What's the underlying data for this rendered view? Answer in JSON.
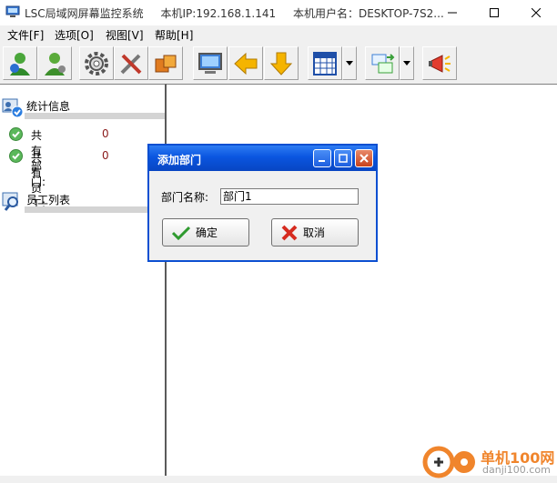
{
  "titlebar": {
    "app_name": "LSC局域网屏幕监控系统",
    "ip": "本机IP:192.168.1.141",
    "user": "本机用户名：DESKTOP-7S2..."
  },
  "menu": [
    "文件[F]",
    "选项[O]",
    "视图[V]",
    "帮助[H]"
  ],
  "toolbar": {
    "icons": [
      "user-green-icon",
      "user-gray-icon",
      "gear-icon",
      "tools-icon",
      "boxes-icon",
      "monitor-icon",
      "arrow-left-icon",
      "arrow-down-icon",
      "calendar-grid-icon",
      "transfer-icon",
      "megaphone-icon"
    ]
  },
  "sidebar": {
    "stats_title": "统计信息",
    "dept_label": "共有部门:",
    "dept_count": "0",
    "emp_label": "共有员工:",
    "emp_count": "0",
    "employees_title": "员工列表"
  },
  "dialog": {
    "title": "添加部门",
    "field_label": "部门名称:",
    "field_value": "部门1",
    "ok_label": "确定",
    "cancel_label": "取消"
  },
  "watermark": {
    "brand": "单机100网",
    "url": "danji100.com"
  },
  "colors": {
    "dialog_title_bg": "#0a55e0",
    "count_color": "#8b1a1a",
    "watermark_orange": "#f0852c"
  }
}
